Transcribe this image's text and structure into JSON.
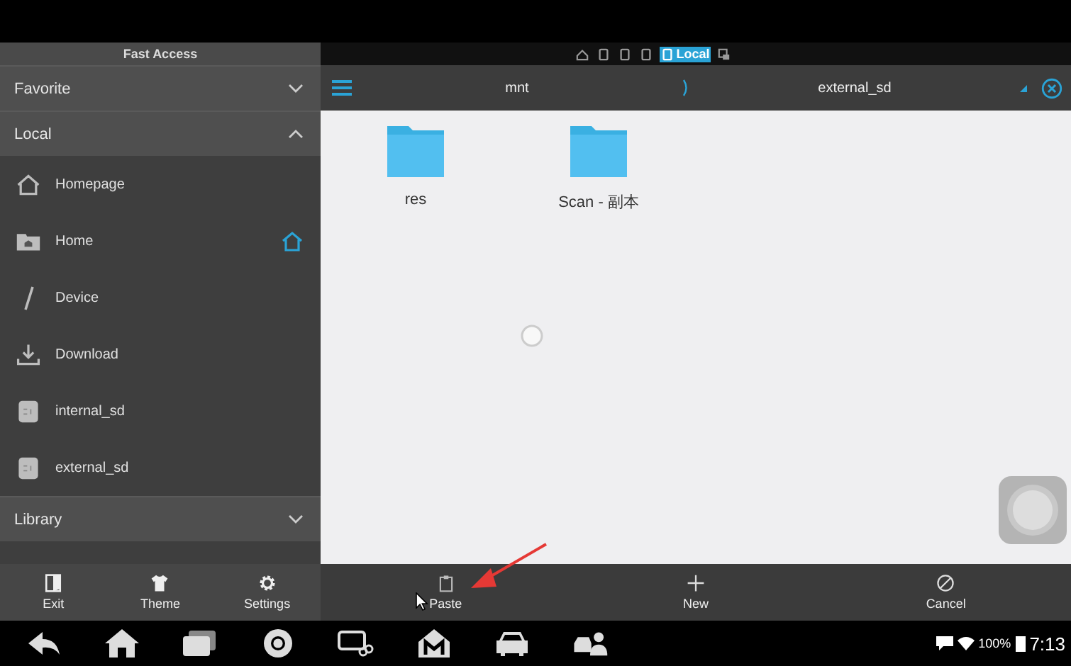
{
  "sidebar": {
    "title": "Fast Access",
    "sections": [
      {
        "label": "Favorite",
        "expanded": false
      },
      {
        "label": "Local",
        "expanded": true,
        "items": [
          {
            "label": "Homepage",
            "kind": "house",
            "default": false
          },
          {
            "label": "Home",
            "kind": "folder",
            "default": true
          },
          {
            "label": "Device",
            "kind": "slash",
            "default": false
          },
          {
            "label": "Download",
            "kind": "download",
            "default": false
          },
          {
            "label": "internal_sd",
            "kind": "sd",
            "default": false
          },
          {
            "label": "external_sd",
            "kind": "sd",
            "default": false
          }
        ]
      },
      {
        "label": "Library",
        "expanded": false
      }
    ],
    "toolbar": [
      {
        "label": "Exit",
        "kind": "exit"
      },
      {
        "label": "Theme",
        "kind": "shirt"
      },
      {
        "label": "Settings",
        "kind": "gear"
      }
    ]
  },
  "storage_tabs": [
    {
      "kind": "home",
      "selected": false
    },
    {
      "kind": "device",
      "selected": false
    },
    {
      "kind": "device",
      "selected": false
    },
    {
      "kind": "device",
      "selected": false
    },
    {
      "kind": "device",
      "label": "Local",
      "selected": true
    },
    {
      "kind": "network",
      "selected": false
    }
  ],
  "path_bar": {
    "segments": [
      "mnt",
      "external_sd"
    ]
  },
  "files": [
    {
      "name": "res"
    },
    {
      "name": "Scan - 副本"
    }
  ],
  "toolbar": [
    {
      "label": "Paste",
      "kind": "paste"
    },
    {
      "label": "New",
      "kind": "plus"
    },
    {
      "label": "Cancel",
      "kind": "cancel"
    }
  ],
  "status_bar": {
    "battery": "100%",
    "time": "7:13"
  }
}
